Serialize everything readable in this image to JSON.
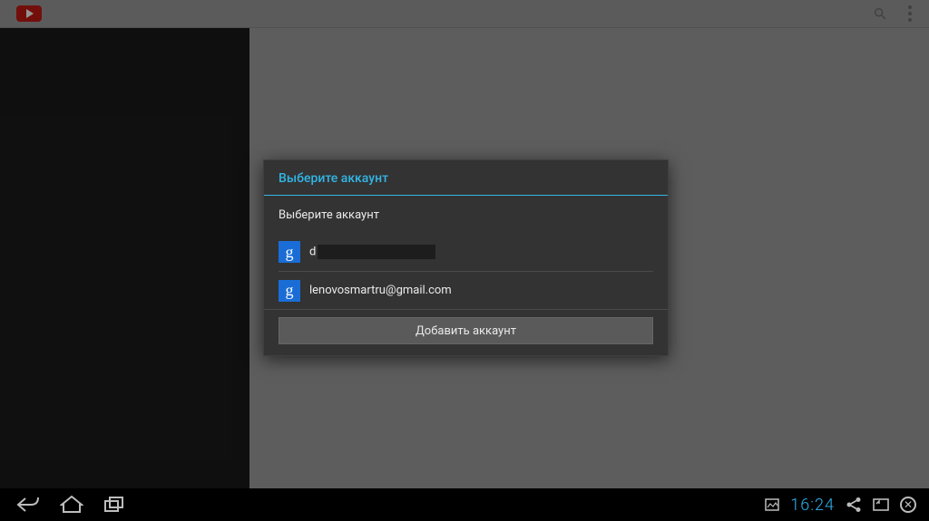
{
  "dialog": {
    "title": "Выберите аккаунт",
    "subtitle": "Выберите аккаунт",
    "accounts": [
      {
        "prefix": "d",
        "email_redacted": true
      },
      {
        "email": "lenovosmartru@gmail.com",
        "email_redacted": false
      }
    ],
    "add_account_label": "Добавить аккаунт"
  },
  "navbar": {
    "clock": "16:24"
  },
  "icons": {
    "google_letter": "g"
  }
}
